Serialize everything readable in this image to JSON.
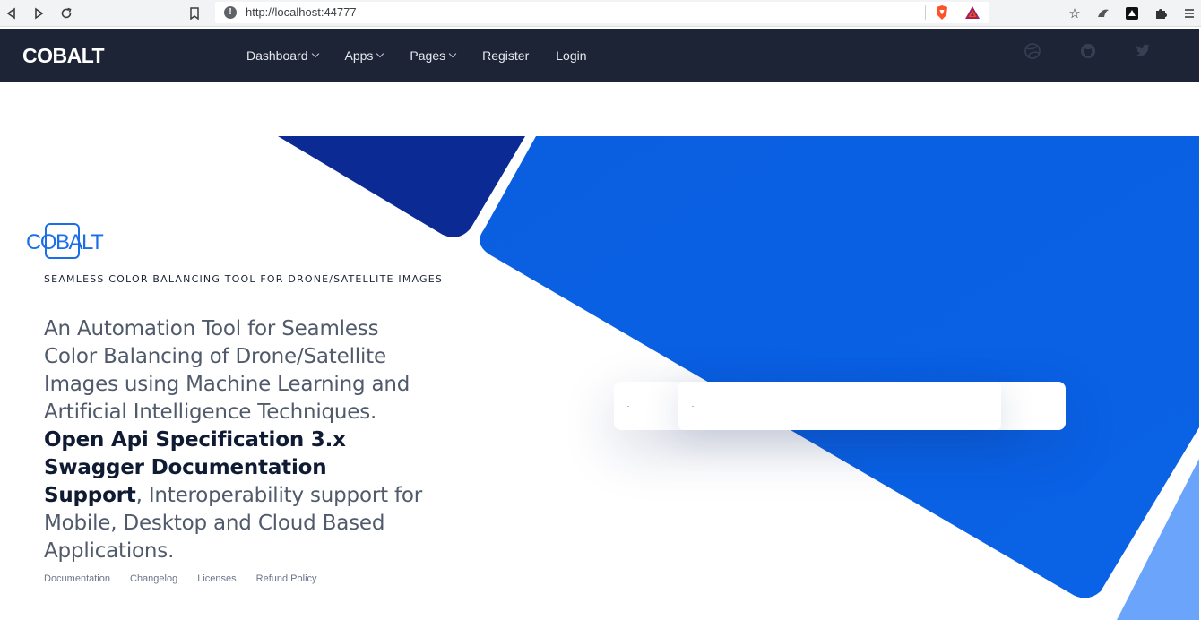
{
  "browser": {
    "url": "http://localhost:44777"
  },
  "navbar": {
    "brand": "COBALT",
    "items": [
      {
        "label": "Dashboard",
        "has_dropdown": true
      },
      {
        "label": "Apps",
        "has_dropdown": true
      },
      {
        "label": "Pages",
        "has_dropdown": true
      },
      {
        "label": "Register",
        "has_dropdown": false
      },
      {
        "label": "Login",
        "has_dropdown": false
      }
    ],
    "social_icons": [
      "dribbble-icon",
      "github-icon",
      "twitter-icon"
    ]
  },
  "hero": {
    "logo_text": "COBALT",
    "tagline": "SEAMLESS COLOR BALANCING TOOL FOR DRONE/SATELLITE IMAGES",
    "lead_part1": "An Automation Tool for Seamless Color Balancing of Drone/Satellite Images using Machine Learning and Artificial Intelligence Techniques.",
    "lead_bold": "Open Api Specification 3.x Swagger Documentation Support",
    "lead_part2": ", Interoperability support for Mobile, Desktop and Cloud Based Applications."
  },
  "footer_links": [
    "Documentation",
    "Changelog",
    "Licenses",
    "Refund Policy"
  ],
  "colors": {
    "navbar_bg": "#1c2436",
    "shape_dark": "#0a2fa0",
    "shape_main": "#0a5fe0",
    "shape_light": "#6aa4fb",
    "accent": "#1b6ee8"
  }
}
